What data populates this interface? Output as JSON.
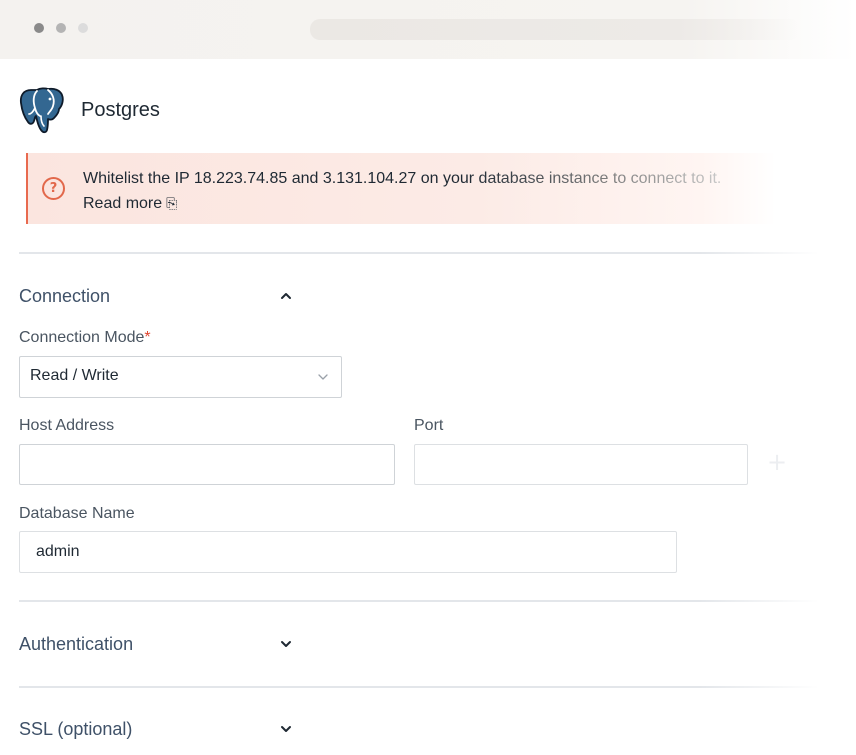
{
  "window": {
    "controls": [
      "close-dot",
      "minimize-dot",
      "maximize-dot"
    ]
  },
  "header": {
    "title": "Postgres",
    "logo_icon": "postgres-elephant-icon"
  },
  "alert": {
    "icon": "question-circle-icon",
    "message": "Whitelist the IP 18.223.74.85 and 3.131.104.27 on your database instance to connect to it.",
    "read_more": "Read more",
    "read_more_icon": "external-link-icon",
    "accent_color": "#e86a4f"
  },
  "sections": {
    "connection": {
      "title": "Connection",
      "state": "expanded",
      "connection_mode": {
        "label": "Connection Mode",
        "required_mark": "*",
        "value": "Read / Write"
      },
      "host": {
        "label": "Host Address",
        "value": "",
        "placeholder": ""
      },
      "port": {
        "label": "Port",
        "value": "",
        "placeholder": ""
      },
      "add_icon": "plus-icon",
      "database": {
        "label": "Database Name",
        "value": "admin"
      }
    },
    "authentication": {
      "title": "Authentication",
      "state": "collapsed"
    },
    "ssl": {
      "title": "SSL (optional)",
      "state": "collapsed"
    }
  },
  "colors": {
    "section_title": "#3f5168",
    "required": "#e0452f",
    "logo_blue": "#336791"
  }
}
